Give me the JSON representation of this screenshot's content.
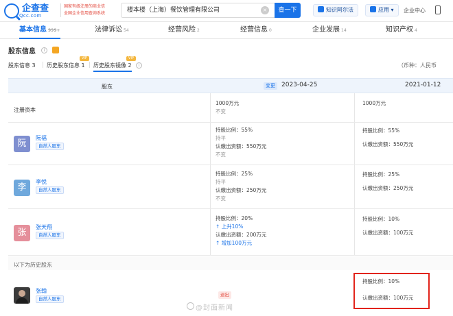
{
  "header": {
    "logo_text": "企查查",
    "logo_sub": "Qcc.com",
    "slogan_line1": "国家有级注册的商业信",
    "slogan_line2": "全国企业信用查询系统",
    "search_value": "楼本楼（上海）餐饮管理有限公司",
    "search_clear": "×",
    "search_button": "查一下",
    "pill1": "知识阿尔法",
    "pill2": "应用 ▾",
    "link_center": "企业中心"
  },
  "tabs": [
    {
      "label": "基本信息",
      "count": "999+"
    },
    {
      "label": "法律诉讼",
      "count": "54"
    },
    {
      "label": "经营风险",
      "count": "2"
    },
    {
      "label": "经营信息",
      "count": "0"
    },
    {
      "label": "企业发展",
      "count": "14"
    },
    {
      "label": "知识产权",
      "count": "4"
    }
  ],
  "section": {
    "title": "股东信息",
    "info": "i",
    "subtabs": [
      "股东信息 3",
      "历史股东信息 1",
      "历史股东镜像 2"
    ],
    "vip": "VIP",
    "currency": "（币种：人民币"
  },
  "table": {
    "col_shareholder": "股东",
    "change_tag": "变更",
    "date1": "2023-04-25",
    "date2": "2021-01-12",
    "registered_capital_label": "注册资本",
    "capital": {
      "new_value": "1000万元",
      "new_note": "不变",
      "old_value": "1000万元"
    },
    "rows": [
      {
        "avatar": "阮",
        "name": "阮福",
        "tag": "自然人股东",
        "new_ratio": "持股比例：55%",
        "new_ratio_note": "持平",
        "new_amount": "认缴出资额：550万元",
        "new_amount_note": "不变",
        "old_ratio": "持股比例：55%",
        "old_amount": "认缴出资额：550万元"
      },
      {
        "avatar": "李",
        "name": "李悦",
        "tag": "自然人股东",
        "new_ratio": "持股比例：25%",
        "new_ratio_note": "持平",
        "new_amount": "认缴出资额：250万元",
        "new_amount_note": "不变",
        "old_ratio": "持股比例：25%",
        "old_amount": "认缴出资额：250万元"
      },
      {
        "avatar": "张",
        "name": "张天翔",
        "tag": "自然人股东",
        "new_ratio": "持股比例：20%",
        "new_ratio_note": "↑ 上升10%",
        "new_amount": "认缴出资额：200万元",
        "new_amount_note": "↑ 增加100万元",
        "old_ratio": "持股比例：10%",
        "old_amount": "认缴出资额：100万元"
      }
    ],
    "history_label": "以下为历史股东",
    "history_row": {
      "name": "张翰",
      "tag": "自然人股东",
      "exit_tag": "退出",
      "old_ratio": "持股比例：10%",
      "old_amount": "认缴出资额：100万元"
    }
  },
  "watermark": "@封面新闻",
  "colors": {
    "accent": "#1a73e8",
    "highlight_box": "#e2231a",
    "avatar_ruan": "#7f8fd0",
    "avatar_li": "#6fa8dc",
    "avatar_zhang": "#e58f9b"
  }
}
